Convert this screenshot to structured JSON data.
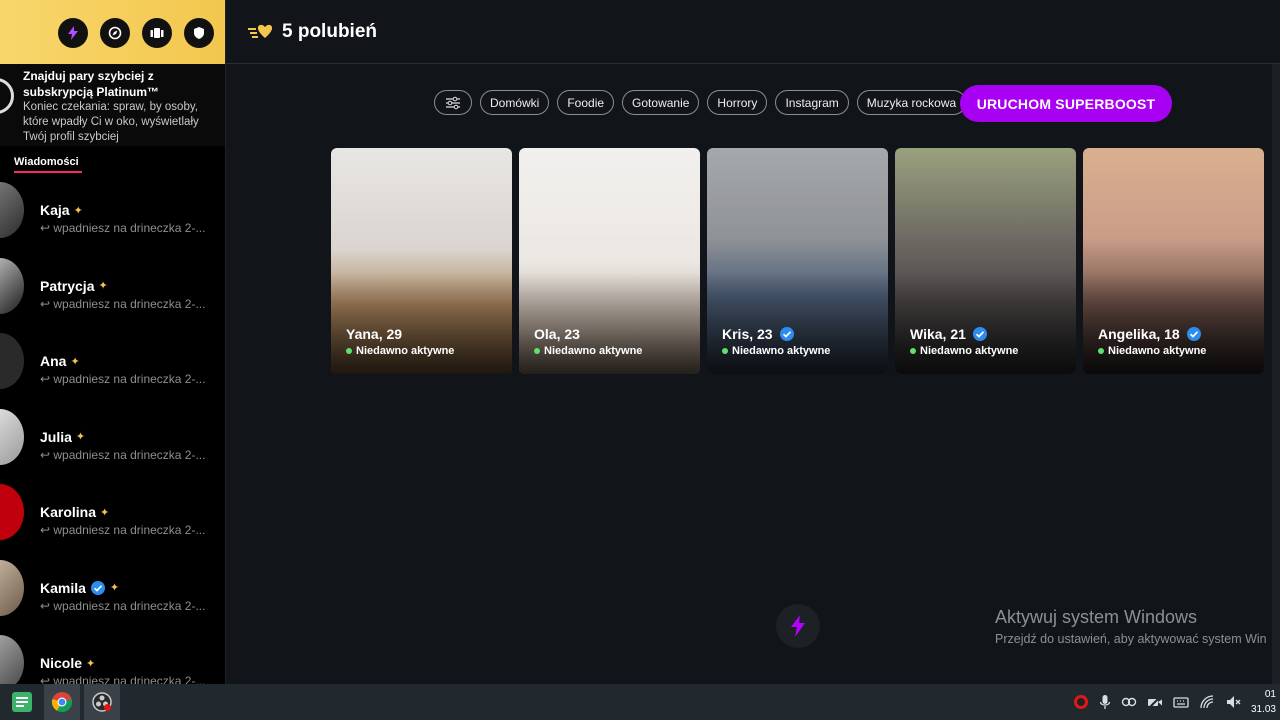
{
  "sidebar": {
    "promo": {
      "title": "Znajduj pary szybciej z subskrypcją Platinum™",
      "desc": "Koniec czekania: spraw, by osoby, które wpadły Ci w oko, wyświetlały Twój profil szybciej"
    },
    "tab_label": "Wiadomości",
    "messages": [
      {
        "name": "Kaja",
        "snippet": "wpadniesz na drineczka 2-..."
      },
      {
        "name": "Patrycja",
        "snippet": "wpadniesz na drineczka 2-..."
      },
      {
        "name": "Ana",
        "snippet": "wpadniesz na drineczka 2-..."
      },
      {
        "name": "Julia",
        "snippet": "wpadniesz na drineczka 2-..."
      },
      {
        "name": "Karolina",
        "snippet": "wpadniesz na drineczka 2-..."
      },
      {
        "name": "Kamila",
        "snippet": "wpadniesz na drineczka 2-..."
      },
      {
        "name": "Nicole",
        "snippet": "wpadniesz na drineczka 2-..."
      }
    ]
  },
  "main": {
    "likes_title": "5 polubień",
    "filters": [
      "Domówki",
      "Foodie",
      "Gotowanie",
      "Horrory",
      "Instagram",
      "Muzyka rockowa"
    ],
    "superboost_label": "URUCHOM SUPERBOOST",
    "cards": [
      {
        "name": "Yana, 29",
        "status": "Niedawno aktywne",
        "verified": false
      },
      {
        "name": "Ola, 23",
        "status": "Niedawno aktywne",
        "verified": false
      },
      {
        "name": "Kris, 23",
        "status": "Niedawno aktywne",
        "verified": true
      },
      {
        "name": "Wika, 21",
        "status": "Niedawno aktywne",
        "verified": true
      },
      {
        "name": "Angelika, 18",
        "status": "Niedawno aktywne",
        "verified": true
      }
    ]
  },
  "watermark": {
    "line1": "Aktywuj system Windows",
    "line2": "Przejdź do ustawień, aby aktywować system Win"
  },
  "taskbar": {
    "clock_time": "01",
    "clock_date": "31.03"
  },
  "colors": {
    "accent_pink": "#fd2671",
    "superboost_purple": "#a800f2",
    "gold": "#f3c74e",
    "online_green": "#5ee26c"
  }
}
